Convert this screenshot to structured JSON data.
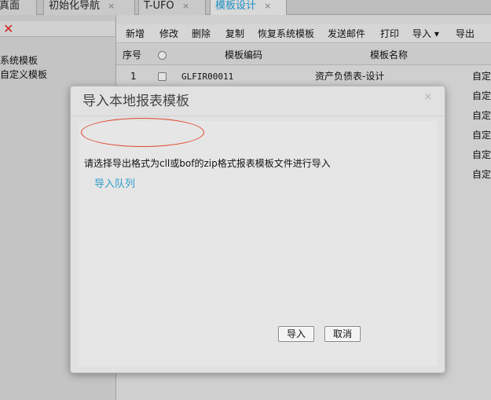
{
  "tabs": [
    {
      "label": "真面",
      "close": ""
    },
    {
      "label": "初始化导航",
      "close": "×"
    },
    {
      "label": "T-UFO",
      "close": "×"
    },
    {
      "label": "模板设计",
      "close": "×"
    }
  ],
  "tree": {
    "close_glyph": "✕",
    "items": [
      "系统模板",
      "自定义模板"
    ]
  },
  "toolbar": {
    "new": "新增",
    "edit": "修改",
    "delete": "删除",
    "copy": "复制",
    "restore": "恢复系统模板",
    "send_mail": "发送邮件",
    "print": "打印",
    "import": "导入 ▾",
    "export": "导出"
  },
  "grid": {
    "col_index": "序号",
    "col_code": "模板编码",
    "col_name": "模板名称",
    "rows": [
      {
        "index": "1",
        "code": "GLFIR00011",
        "name": "资产负债表-设计",
        "type": "自定"
      },
      {
        "index": "",
        "code": "",
        "name": "",
        "type": "自定"
      },
      {
        "index": "",
        "code": "",
        "name": "",
        "type": "自定"
      },
      {
        "index": "",
        "code": "",
        "name": "",
        "type": "自定"
      },
      {
        "index": "",
        "code": "",
        "name": "",
        "type": "自定"
      },
      {
        "index": "",
        "code": "",
        "name": "",
        "type": "自定"
      }
    ]
  },
  "modal": {
    "title": "导入本地报表模板",
    "close_glyph": "×",
    "instruction": "请选择导出格式为cll或bof的zip格式报表模板文件进行导入",
    "queue_link": "导入队列",
    "import_button": "导入",
    "cancel_button": "取消"
  },
  "colors": {
    "accent_link": "#2f9fc9",
    "annotation_red": "#e0452e",
    "close_x": "#d02020"
  }
}
